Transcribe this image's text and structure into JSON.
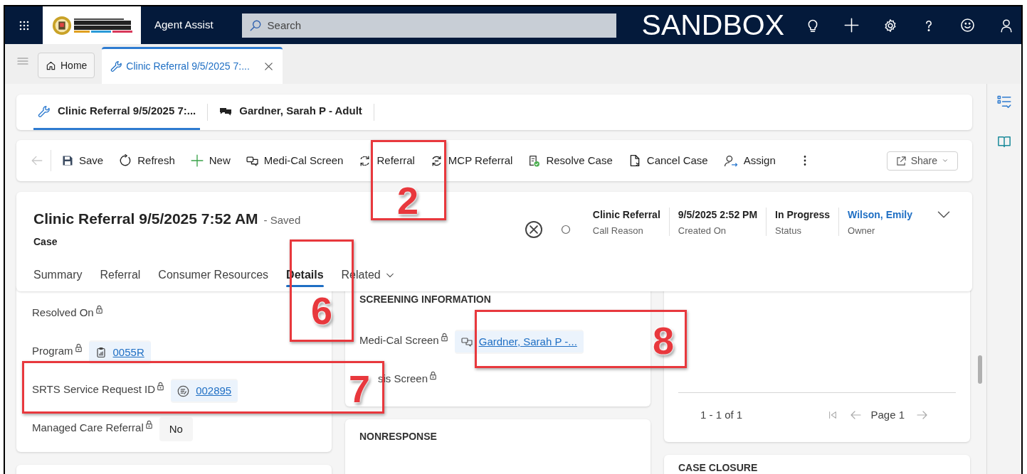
{
  "app_bar": {
    "title": "Agent Assist",
    "search": {
      "placeholder": "Search"
    },
    "environment": "SANDBOX"
  },
  "app_tabs": [
    {
      "label": "Home",
      "selected": false
    },
    {
      "label": "Clinic Referral 9/5/2025 7:...",
      "selected": true
    }
  ],
  "session_tabs": [
    {
      "label": "Clinic Referral 9/5/2025 7:...",
      "selected": true
    },
    {
      "label": "Gardner, Sarah P - Adult",
      "selected": false
    }
  ],
  "commands": [
    {
      "label": "Save"
    },
    {
      "label": "Refresh"
    },
    {
      "label": "New"
    },
    {
      "label": "Medi-Cal Screen"
    },
    {
      "label": "Referral"
    },
    {
      "label": "MCP Referral"
    },
    {
      "label": "Resolve Case"
    },
    {
      "label": "Cancel Case"
    },
    {
      "label": "Assign"
    }
  ],
  "share_button": {
    "label": "Share"
  },
  "record": {
    "title": "Clinic Referral 9/5/2025 7:52 AM",
    "save_status": "- Saved",
    "entity": "Case",
    "header_fields": [
      {
        "value": "Clinic Referral",
        "label": "Call Reason",
        "kind": "text"
      },
      {
        "value": "9/5/2025 2:52 PM",
        "label": "Created On",
        "kind": "text"
      },
      {
        "value": "In Progress",
        "label": "Status",
        "kind": "text"
      },
      {
        "value": "Wilson, Emily",
        "label": "Owner",
        "kind": "link"
      }
    ]
  },
  "form_tabs": [
    {
      "label": "Summary",
      "selected": false,
      "kind": "tab"
    },
    {
      "label": "Referral",
      "selected": false,
      "kind": "tab"
    },
    {
      "label": "Consumer Resources",
      "selected": false,
      "kind": "tab"
    },
    {
      "label": "Details",
      "selected": true,
      "kind": "tab"
    },
    {
      "label": "Related",
      "selected": false,
      "kind": "menu"
    }
  ],
  "details_fields": [
    {
      "label": "Resolved On",
      "kind": "empty",
      "locked": true
    },
    {
      "label": "Program",
      "value": "0055R",
      "kind": "lookup",
      "locked": true
    },
    {
      "label": "SRTS Service Request ID",
      "value": "002895",
      "kind": "lookup",
      "locked": true
    },
    {
      "label": "Managed Care Referral",
      "value": "No",
      "kind": "text",
      "locked": true
    }
  ],
  "screening_section": {
    "title": "SCREENING INFORMATION",
    "fields": [
      {
        "label": "Medi-Cal Screen",
        "value": "Gardner, Sarah P -...",
        "kind": "lookup",
        "locked": true
      },
      {
        "label": "sis Screen",
        "kind": "empty",
        "locked": true
      }
    ]
  },
  "nonresponse_section": {
    "title": "NONRESPONSE"
  },
  "subgrid": {
    "record_count": "1 - 1 of 1",
    "page": "Page 1"
  },
  "case_closure_section": {
    "title": "CASE CLOSURE"
  },
  "annotations": [
    {
      "number": "2"
    },
    {
      "number": "6"
    },
    {
      "number": "7"
    },
    {
      "number": "8"
    }
  ]
}
